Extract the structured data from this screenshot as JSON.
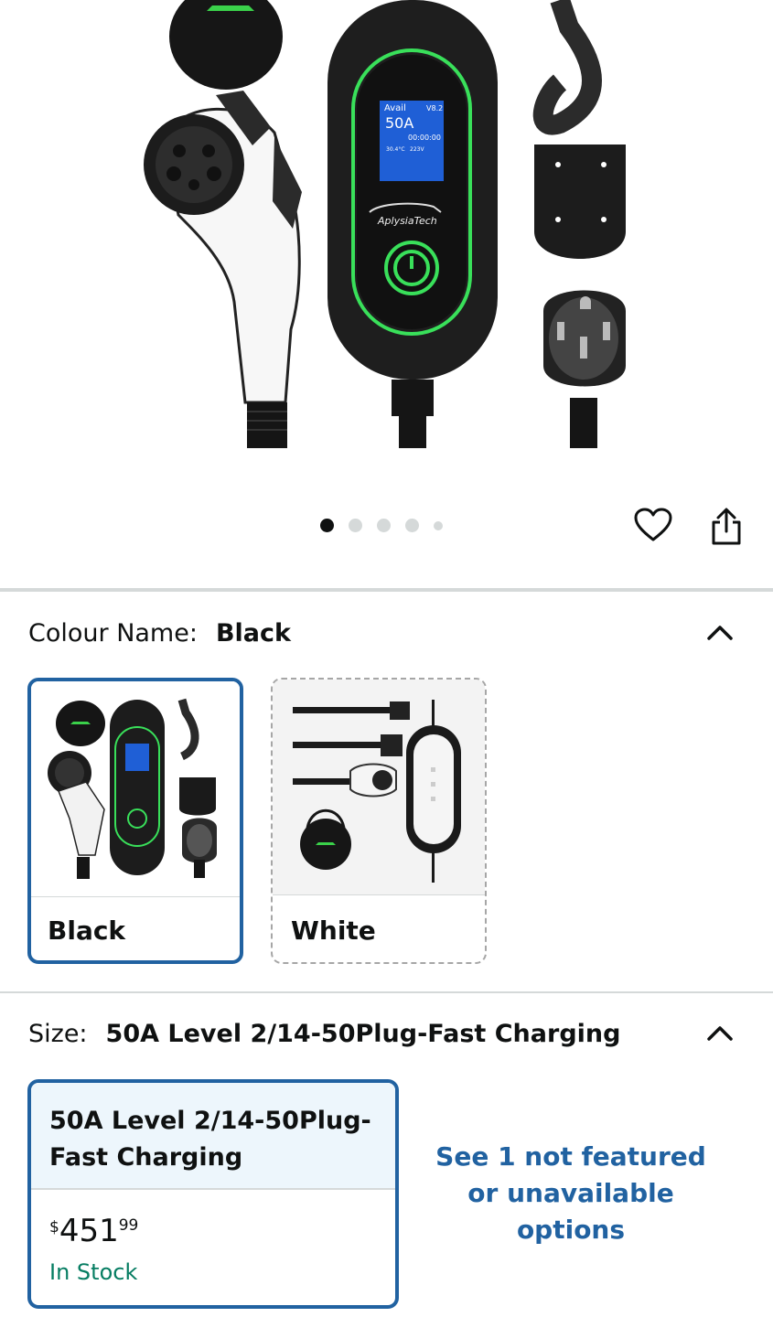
{
  "hero": {
    "screen_brand": "AplysiaTech",
    "screen_avail": "Avail",
    "screen_version": "V8.2",
    "screen_amps": "50A",
    "screen_timer": "00:00:00",
    "screen_temp": "30.4°C",
    "screen_voltage": "223V"
  },
  "carousel": {
    "total": 5,
    "active_index": 0
  },
  "colour": {
    "label": "Colour Name:",
    "value": "Black",
    "options": [
      {
        "label": "Black",
        "selected": true
      },
      {
        "label": "White",
        "selected": false
      }
    ]
  },
  "size": {
    "label": "Size:",
    "value": "50A Level 2/14-50Plug-Fast Charging",
    "option": {
      "line1": "50A Level 2/14-50Plug-",
      "line2": "Fast Charging",
      "currency": "$",
      "price_whole": "451",
      "price_fraction": "99",
      "availability": "In Stock"
    },
    "more_link": "See 1 not featured or unavailable options"
  },
  "icons": {
    "favorite": "heart-icon",
    "share": "share-icon",
    "collapse": "chevron-up-icon"
  },
  "colors": {
    "accent": "#2162a1",
    "in_stock": "#067d62",
    "led_green": "#39e05a"
  }
}
